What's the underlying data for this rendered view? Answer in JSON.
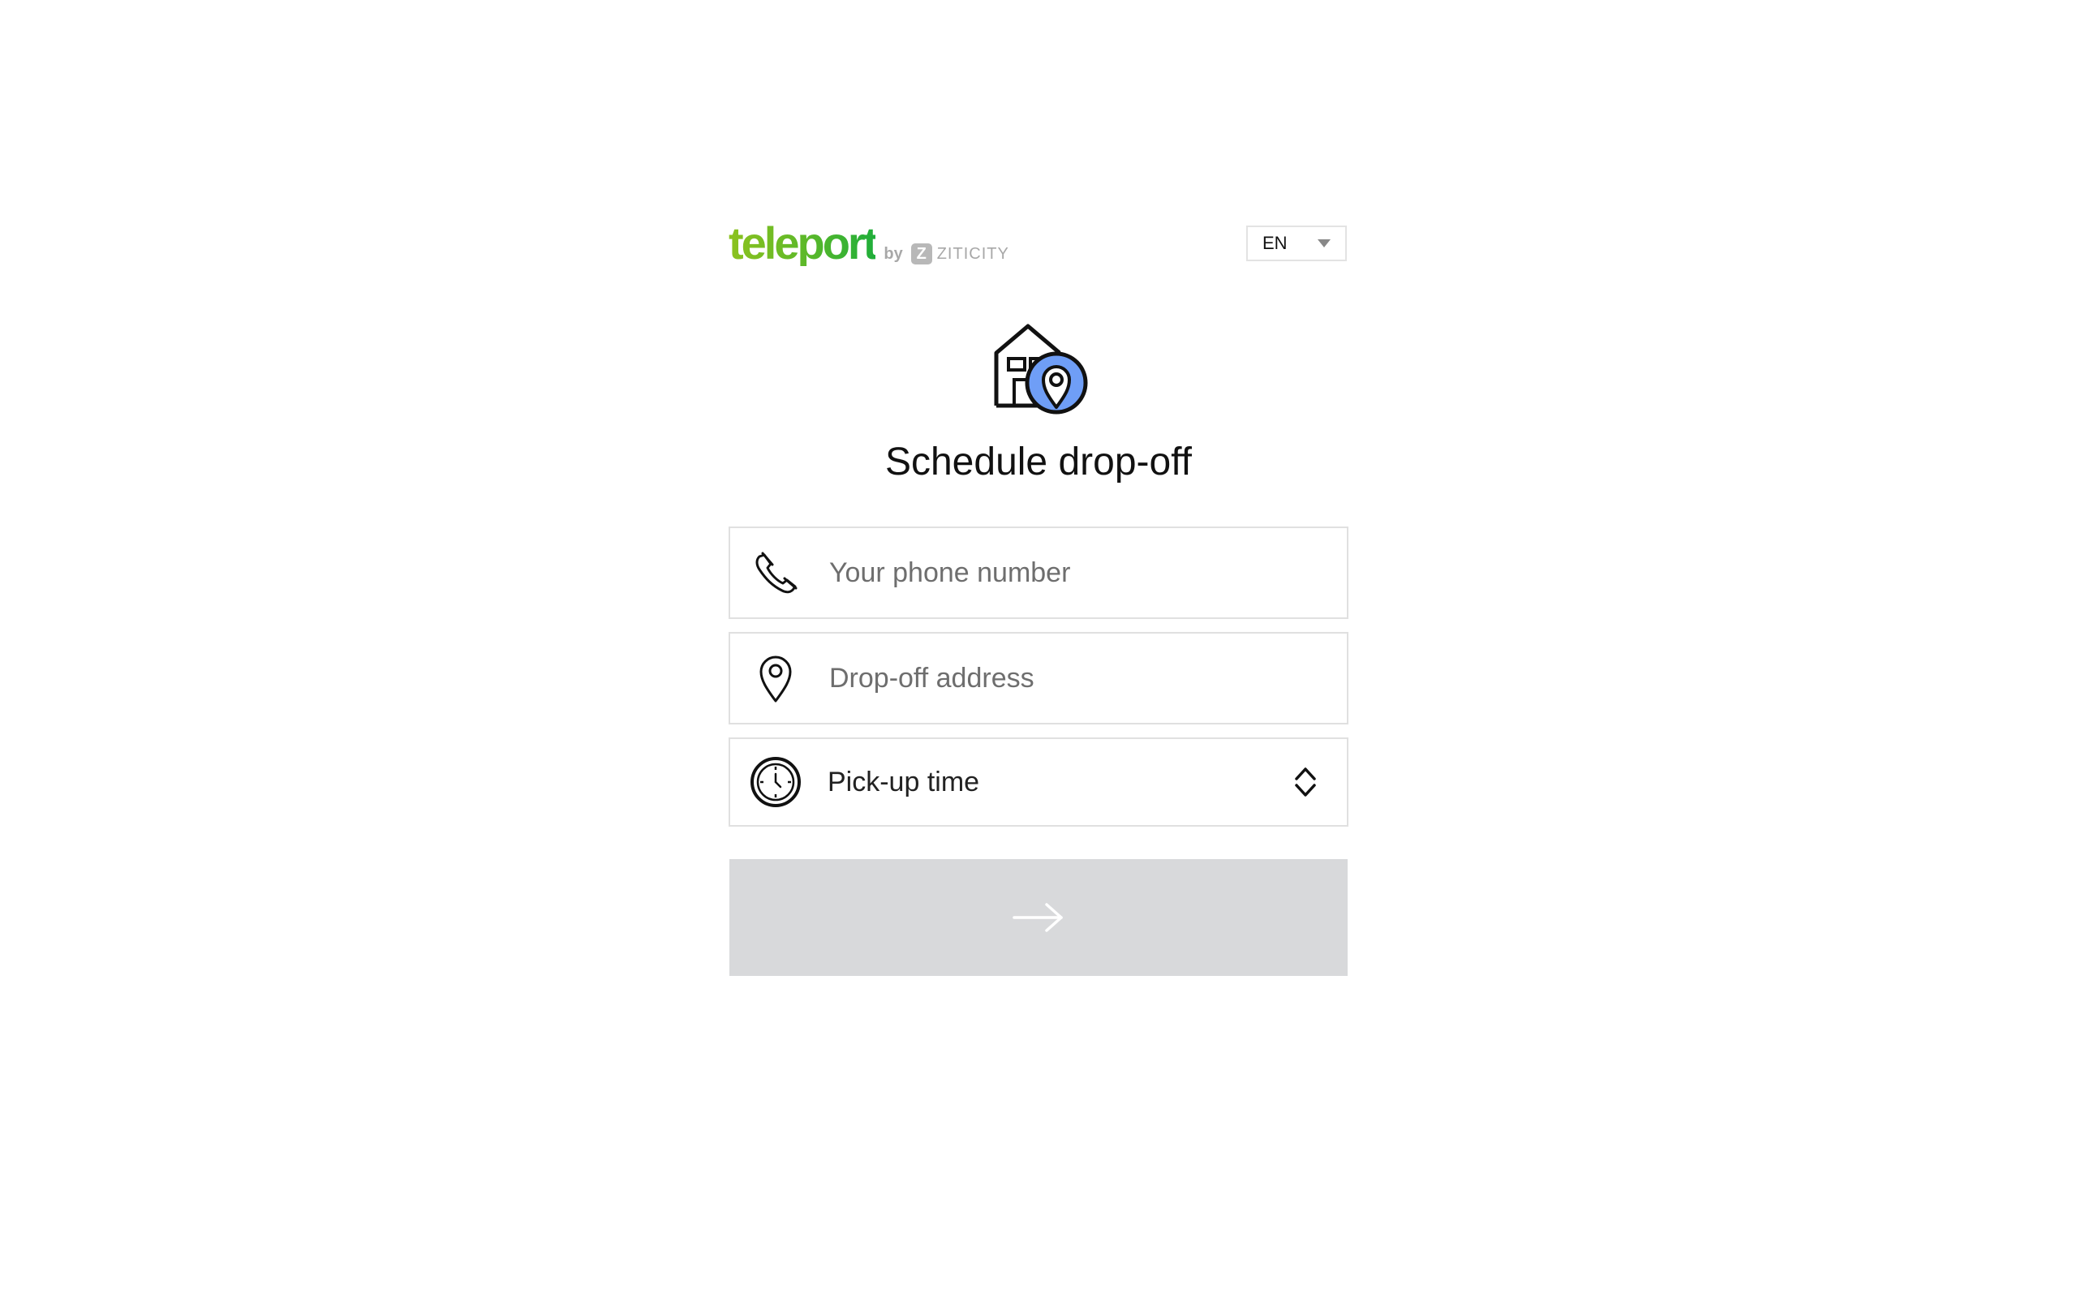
{
  "header": {
    "logo_main": "teleport",
    "logo_by": "by",
    "logo_z": "Z",
    "logo_brand": "ZITICITY",
    "language": {
      "selected": "EN"
    }
  },
  "page": {
    "title": "Schedule drop-off"
  },
  "form": {
    "phone": {
      "value": "",
      "placeholder": "Your phone number",
      "icon": "phone-icon"
    },
    "address": {
      "value": "",
      "placeholder": "Drop-off address",
      "icon": "map-pin-icon"
    },
    "pickup_time": {
      "label": "Pick-up time",
      "icon": "clock-icon"
    },
    "submit": {
      "icon": "arrow-right-icon",
      "color": "#d8d9db"
    }
  },
  "colors": {
    "brand_green": "#8dc21f",
    "accent_blue": "#6f9ef6",
    "border": "#e0e0e0"
  }
}
